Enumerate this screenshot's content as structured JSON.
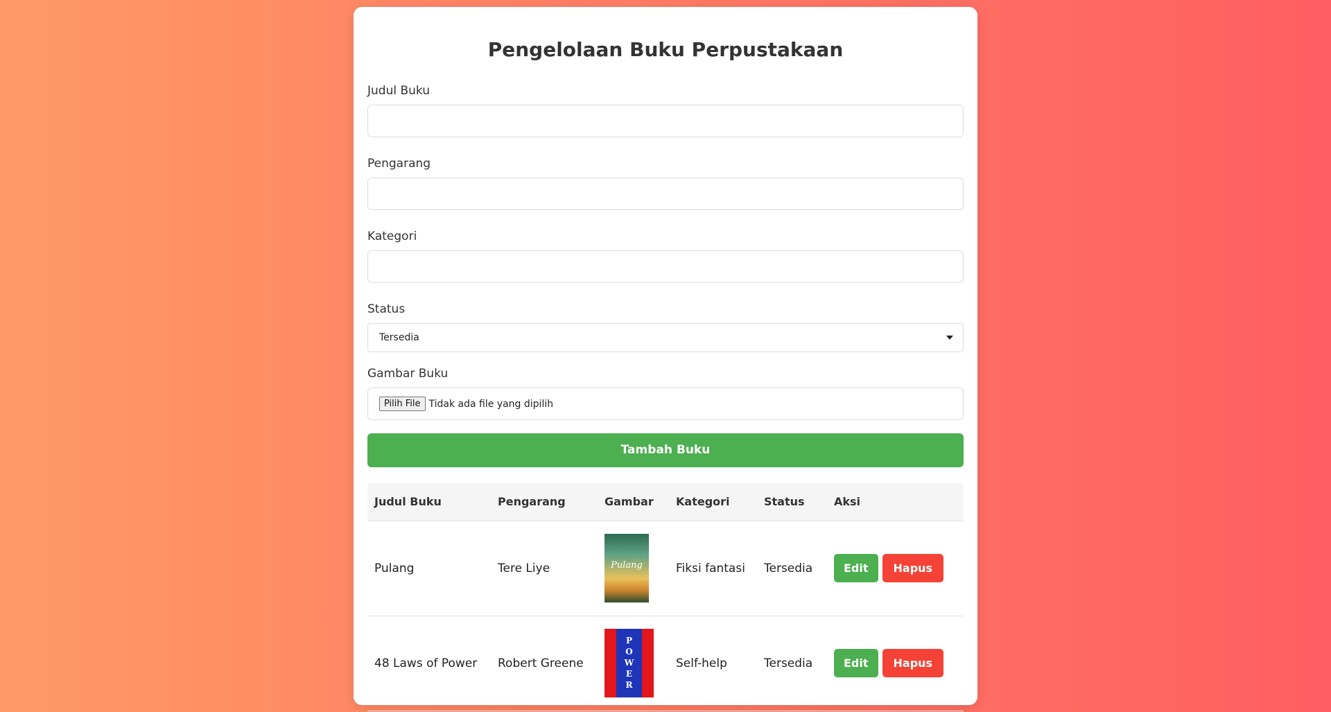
{
  "title": "Pengelolaan Buku Perpustakaan",
  "form": {
    "judul_label": "Judul Buku",
    "judul_value": "",
    "pengarang_label": "Pengarang",
    "pengarang_value": "",
    "kategori_label": "Kategori",
    "kategori_value": "",
    "status_label": "Status",
    "status_selected": "Tersedia",
    "gambar_label": "Gambar Buku",
    "file_button": "Pilih File",
    "file_status": "Tidak ada file yang dipilih",
    "submit_label": "Tambah Buku"
  },
  "table": {
    "headers": [
      "Judul Buku",
      "Pengarang",
      "Gambar",
      "Kategori",
      "Status",
      "Aksi"
    ],
    "rows": [
      {
        "judul": "Pulang",
        "pengarang": "Tere Liye",
        "cover_text": "Pulang",
        "kategori": "Fiksi fantasi",
        "status": "Tersedia",
        "edit_label": "Edit",
        "delete_label": "Hapus"
      },
      {
        "judul": "48 Laws of Power",
        "pengarang": "Robert Greene",
        "cover_text": "POWER",
        "kategori": "Self-help",
        "status": "Tersedia",
        "edit_label": "Edit",
        "delete_label": "Hapus"
      }
    ]
  },
  "colors": {
    "accent_green": "#4caf50",
    "danger_red": "#f44336",
    "background_gradient_start": "#ff9966",
    "background_gradient_end": "#ff5e62"
  }
}
